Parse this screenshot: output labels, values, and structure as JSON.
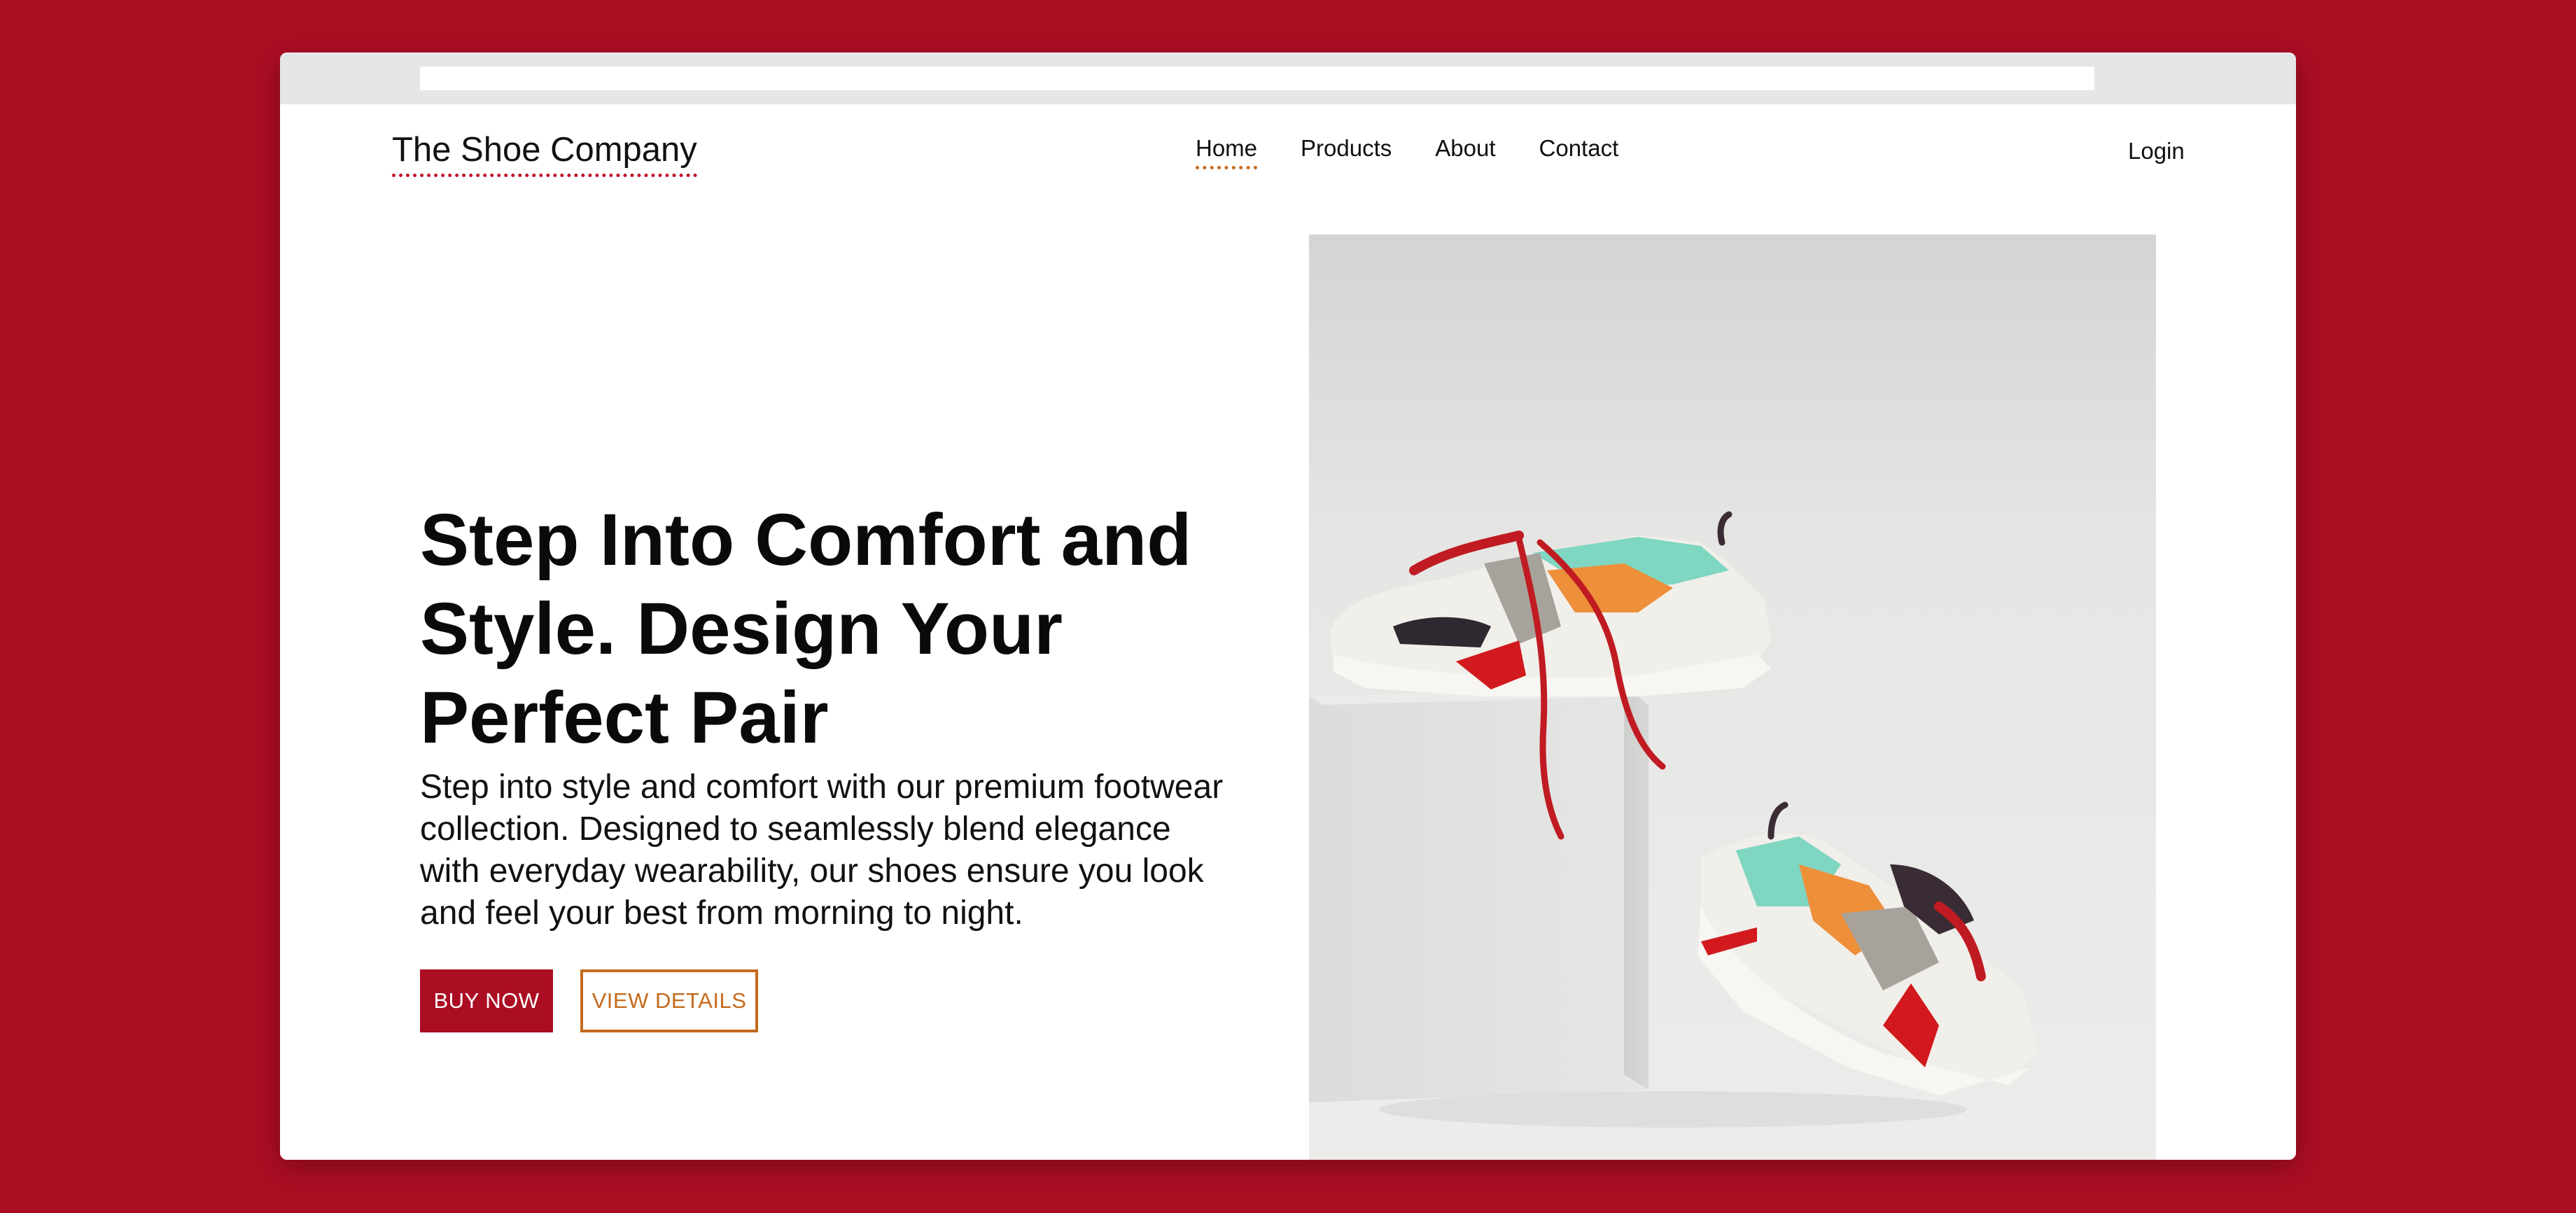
{
  "colors": {
    "brand_red": "#ab0d23",
    "accent_orange": "#c46a1e",
    "text": "#111111",
    "page_background": "#ab0d23"
  },
  "header": {
    "logo": "The Shoe Company",
    "nav": [
      {
        "label": "Home",
        "active": true
      },
      {
        "label": "Products",
        "active": false
      },
      {
        "label": "About",
        "active": false
      },
      {
        "label": "Contact",
        "active": false
      }
    ],
    "login": "Login"
  },
  "hero": {
    "title": "Step Into Comfort and Style. Design Your Perfect Pair",
    "description": "Step into style and comfort with our premium footwear collection. Designed to seamlessly blend elegance with everyday wearability, our shoes ensure you look and feel your best from morning to night.",
    "buy_button": "BUY NOW",
    "details_button": "VIEW DETAILS",
    "image": "sneakers-on-white-pedestal-photo"
  }
}
